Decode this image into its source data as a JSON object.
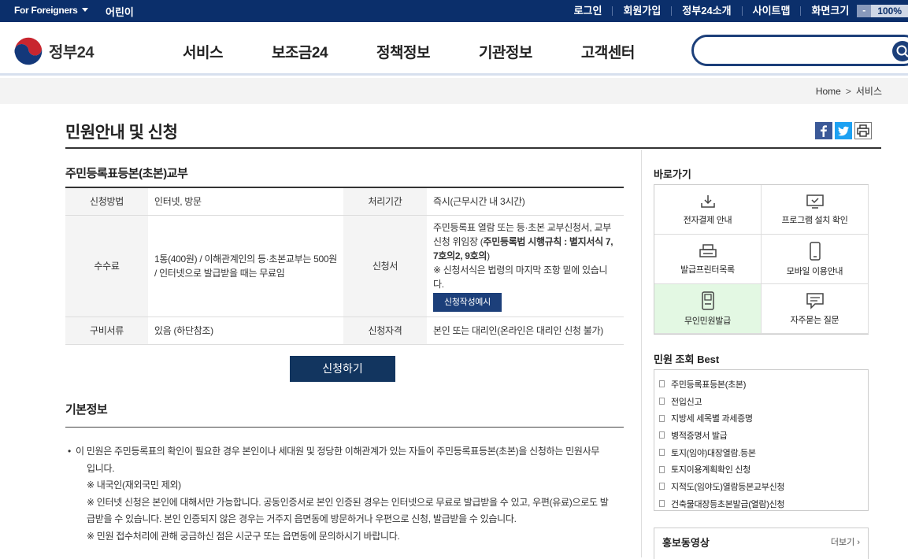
{
  "topbar": {
    "foreigners": "For Foreigners",
    "kids": "어린이",
    "links": [
      "로그인",
      "회원가입",
      "정부24소개",
      "사이트맵",
      "화면크기"
    ],
    "zoom_minus": "-",
    "zoom_value": "100%"
  },
  "header": {
    "logo_text": "정부24",
    "nav": [
      "서비스",
      "보조금24",
      "정책정보",
      "기관정보",
      "고객센터"
    ],
    "search_placeholder": ""
  },
  "breadcrumb": {
    "home": "Home",
    "sep": ">",
    "current": "서비스"
  },
  "page_title": "민원안내 및 신청",
  "share": {
    "facebook": "f",
    "twitter": "t",
    "print": "print"
  },
  "service_title": "주민등록표등본(초본)교부",
  "table": {
    "method_label": "신청방법",
    "method_value": "인터넷, 방문",
    "period_label": "처리기간",
    "period_value": "즉시(근무시간 내 3시간)",
    "fee_label": "수수료",
    "fee_value": "1통(400원) / 이해관계인의 등·초본교부는 500원 / 인터넷으로 발급받을 때는 무료임",
    "form_label": "신청서",
    "form_value_1": "주민등록표 열람 또는 등·초본 교부신청서, 교부신청 위임장 (",
    "form_value_bold": "주민등록법 시행규칙 : 별지서식 7, 7호의2, 9호의",
    "form_value_2": ")",
    "form_note": "※ 신청서식은 법령의 마지막 조항 밑에 있습니다.",
    "form_button": "신청작성예시",
    "docs_label": "구비서류",
    "docs_value": "있음 (하단참조)",
    "qual_label": "신청자격",
    "qual_value": "본인 또는 대리인(온라인은 대리인 신청 불가)"
  },
  "apply_button": "신청하기",
  "basic_title": "기본정보",
  "basic_info": {
    "bullet": "•",
    "line1": "이 민원은 주민등록표의 확인이 필요한 경우 본인이나 세대원 및 정당한 이해관계가 있는 자들이 주민등록표등본(초본)을 신청하는 민원사무",
    "line1b": "입니다.",
    "note1": "※ 내국인(재외국민 제외)",
    "note2a": "※ 인터넷 신청은 본인에 대해서만 가능합니다. 공동인증서로 본인 인증된 경우는 인터넷으로 무료로 발급받을 수 있고, 우편(유료)으로도 발",
    "note2b": "급받을 수 있습니다. 본인 인증되지 않은 경우는 거주지 읍면동에 방문하거나 우편으로 신청, 발급받을 수 있습니다.",
    "note3": "※ 민원 접수처리에 관해 궁금하신 점은 시군구 또는 읍면동에 문의하시기 바랍니다."
  },
  "sidebar": {
    "quick_title": "바로가기",
    "quick": [
      "전자결제 안내",
      "프로그램 설치 확인",
      "발급프린터목록",
      "모바일 이용안내",
      "무인민원발급",
      "자주묻는 질문"
    ],
    "best_title": "민원 조회 Best",
    "best": [
      "주민등록표등본(초본)",
      "전입신고",
      "지방세 세목별 과세증명",
      "병적증명서 발급",
      "토지(임야)대장열람.등본",
      "토지이용계획확인 신청",
      "지적도(임야도)열람등본교부신청",
      "건축물대장등초본발급(열람)신청"
    ],
    "video_title": "홍보동영상",
    "video_more": "더보기 ›"
  },
  "colors": {
    "navy": "#0b2f6b",
    "button": "#12355f",
    "highlight": "#e3f8e3"
  }
}
